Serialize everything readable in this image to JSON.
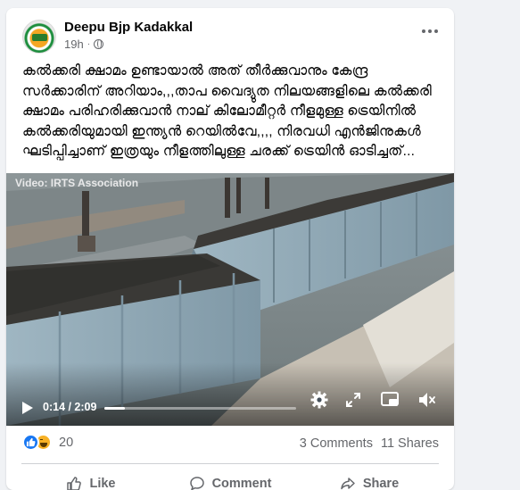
{
  "post": {
    "author": "Deepu Bjp Kadakkal",
    "time": "19h",
    "privacy_icon": "globe-icon",
    "text": "കൽക്കരി ക്ഷാമം ഉണ്ടായാൽ അത് തീർക്കുവാനും കേന്ദ്ര സർക്കാരിന് അറിയാം,,,താപ വൈദ്യുത നിലയങ്ങളിലെ കൽക്കരി ക്ഷാമം പരിഹരിക്കുവാൻ നാല് കിലോമീറ്റർ നീളമുള്ള ട്രെയിനിൽ കൽക്കരിയുമായി ഇന്ത്യൻ റെയിൽവേ,,,, നിരവധി എൻജിനുകൾ ഘടിപ്പിച്ചാണ് ഇത്രയും നീളത്തിലുള്ള ചരക്ക് ട്രെയിൻ ഓടിച്ചത്..."
  },
  "video": {
    "credit": "Video: IRTS Association",
    "time_display": "0:14 / 2:09",
    "progress": 0.108
  },
  "engagement": {
    "reaction_count": "20",
    "comments": "3 Comments",
    "shares": "11 Shares"
  },
  "actions": {
    "like": "Like",
    "comment": "Comment",
    "share": "Share"
  },
  "colors": {
    "like_blue": "#1877f2",
    "haha_yellow": "#f7b125",
    "muted_text": "#65676b"
  }
}
